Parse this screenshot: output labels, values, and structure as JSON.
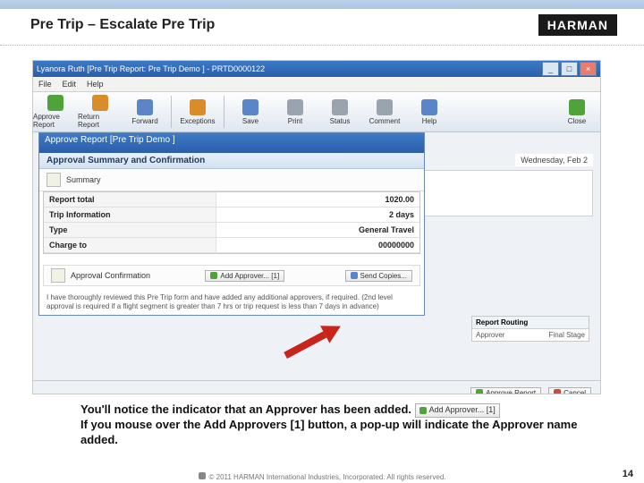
{
  "slide": {
    "title": "Pre Trip – Escalate Pre Trip",
    "logo": "HARMAN",
    "page_number": "14",
    "copyright": "© 2011 HARMAN International Industries, Incorporated.  All rights reserved."
  },
  "window": {
    "title": "Lyanora Ruth [Pre Trip Report: Pre Trip Demo ] - PRTD0000122",
    "menu": {
      "file": "File",
      "edit": "Edit",
      "help": "Help"
    }
  },
  "toolbar": {
    "approve": "Approve Report",
    "return": "Return Report",
    "forward": "Forward",
    "exceptions": "Exceptions",
    "save": "Save",
    "print": "Print",
    "status": "Status",
    "comment": "Comment",
    "help": "Help",
    "close": "Close"
  },
  "date_label": "Wednesday, Feb 2",
  "modal": {
    "title": "Approve Report [Pre Trip Demo ]",
    "subtitle": "Approval Summary and Confirmation",
    "summary_label": "Summary",
    "rows": [
      {
        "label": "Report total",
        "value": "1020.00"
      },
      {
        "label": "Trip Information",
        "value": "2 days"
      },
      {
        "label": "Type",
        "value": "General Travel"
      },
      {
        "label": "Charge to",
        "value": "00000000"
      }
    ],
    "approval_conf": "Approval Confirmation",
    "add_approver": "Add Approver... [1]",
    "send_copies": "Send Copies...",
    "declaration": "I have thoroughly reviewed this Pre Trip form and have added any additional approvers, if required. (2nd level approval is required if a flight segment is greater than 7 hrs or trip request is less than 7 days in advance)",
    "routing_head": "Report Routing",
    "routing_from": "Approver",
    "routing_to": "Final Stage",
    "btn_approve": "Approve Report",
    "btn_cancel": "Cancel"
  },
  "caption": {
    "line1a": "You'll notice the indicator that an Approver has been added.",
    "inline_btn": "Add Approver... [1]",
    "line2": "If you mouse over the Add Approvers [1] button, a pop-up will indicate the Approver name added."
  }
}
